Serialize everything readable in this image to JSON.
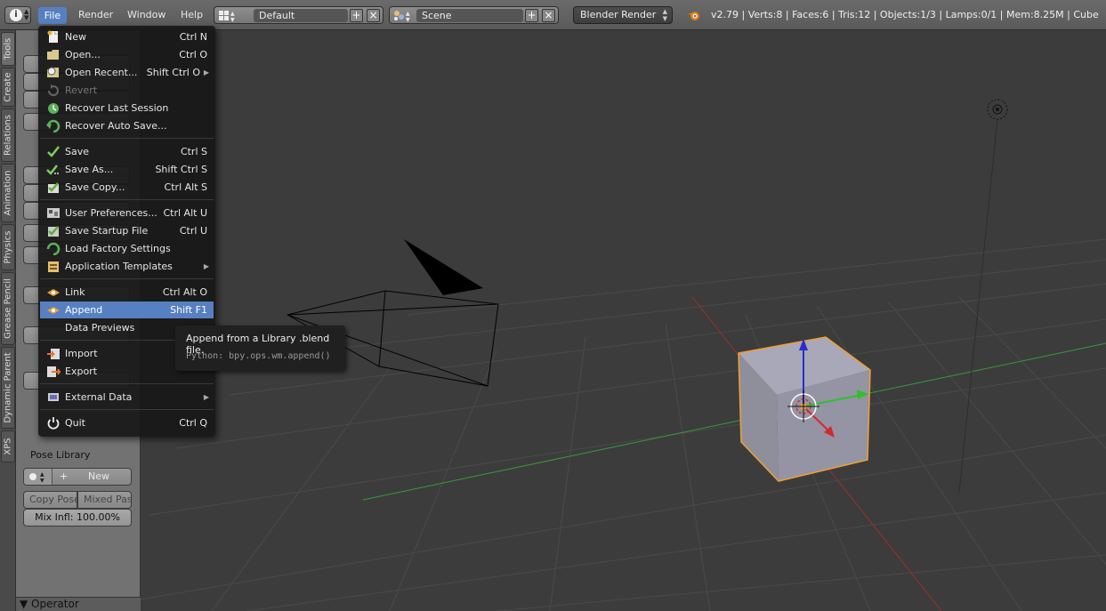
{
  "header": {
    "menus": [
      "File",
      "Render",
      "Window",
      "Help"
    ],
    "screen_layout": "Default",
    "scene": "Scene",
    "render_engine": "Blender Render",
    "stats": "v2.79 | Verts:8 | Faces:6 | Tris:12 | Objects:1/3 | Lamps:0/1 | Mem:8.25M | Cube"
  },
  "tabs": [
    "Tools",
    "Create",
    "Relations",
    "Animation",
    "Physics",
    "Grease Pencil",
    "Dynamic Parent",
    "XPS"
  ],
  "toolshelf": {
    "pose_library_label": "Pose Library",
    "new_label": "New",
    "copy_pose": "Copy Pose",
    "mixed_pas": "Mixed Pas",
    "mix_infl": "Mix Infl: 100.00%",
    "operator": "Operator"
  },
  "file_menu": {
    "items": [
      {
        "label": "New",
        "shortcut": "Ctrl N",
        "icon": "new-file-icon"
      },
      {
        "label": "Open...",
        "shortcut": "Ctrl O",
        "icon": "folder-open-icon"
      },
      {
        "label": "Open Recent...",
        "shortcut": "Shift Ctrl O",
        "icon": "open-recent-icon"
      },
      {
        "label": "Revert",
        "shortcut": "",
        "icon": "revert-icon"
      },
      {
        "label": "Recover Last Session",
        "shortcut": "",
        "icon": "recover-icon"
      },
      {
        "label": "Recover Auto Save...",
        "shortcut": "",
        "icon": "recover-auto-icon"
      },
      {
        "label": "Save",
        "shortcut": "Ctrl S",
        "icon": "checkmark-icon"
      },
      {
        "label": "Save As...",
        "shortcut": "Shift Ctrl S",
        "icon": "save-as-icon"
      },
      {
        "label": "Save Copy...",
        "shortcut": "Ctrl Alt S",
        "icon": "save-copy-icon"
      },
      {
        "label": "User Preferences...",
        "shortcut": "Ctrl Alt U",
        "icon": "preferences-icon"
      },
      {
        "label": "Save Startup File",
        "shortcut": "Ctrl U",
        "icon": "save-startup-icon"
      },
      {
        "label": "Load Factory Settings",
        "shortcut": "",
        "icon": "factory-settings-icon"
      },
      {
        "label": "Application Templates",
        "shortcut": "",
        "icon": "templates-icon"
      },
      {
        "label": "Link",
        "shortcut": "Ctrl Alt O",
        "icon": "link-icon"
      },
      {
        "label": "Append",
        "shortcut": "Shift F1",
        "icon": "append-icon"
      },
      {
        "label": "Data Previews",
        "shortcut": "",
        "icon": ""
      },
      {
        "label": "Import",
        "shortcut": "",
        "icon": "import-icon"
      },
      {
        "label": "Export",
        "shortcut": "",
        "icon": "export-icon"
      },
      {
        "label": "External Data",
        "shortcut": "",
        "icon": "external-data-icon"
      },
      {
        "label": "Quit",
        "shortcut": "Ctrl Q",
        "icon": "power-icon"
      }
    ]
  },
  "tooltip": {
    "title": "Append from a Library .blend file.",
    "python": "Python: bpy.ops.wm.append()"
  },
  "colors": {
    "highlight": "#5680c2",
    "cube_outline": "#f0a030",
    "x_axis": "#b03030",
    "y_axis": "#3aa03a"
  }
}
